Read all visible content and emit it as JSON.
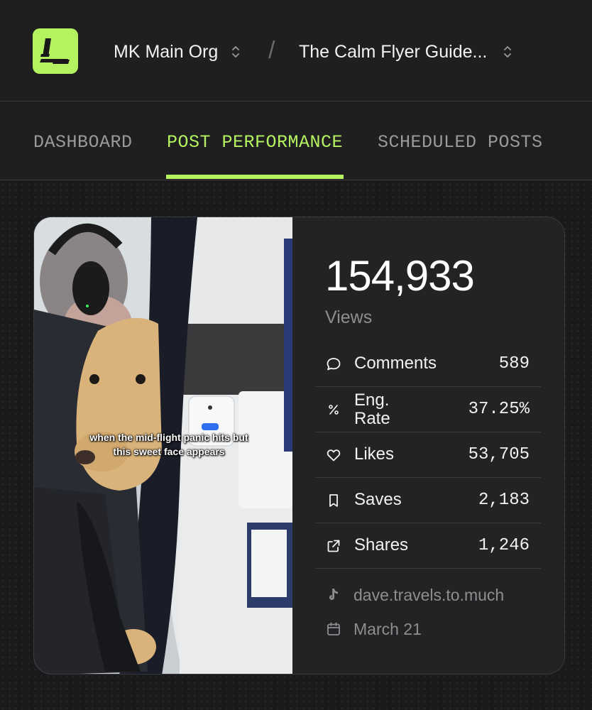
{
  "header": {
    "org_name": "MK Main Org",
    "separator": "/",
    "project_name": "The Calm Flyer Guide..."
  },
  "tabs": [
    {
      "label": "DASHBOARD",
      "active": false
    },
    {
      "label": "POST PERFORMANCE",
      "active": true
    },
    {
      "label": "SCHEDULED POSTS",
      "active": false
    }
  ],
  "post": {
    "caption_line1": "when the mid-flight panic hits but",
    "caption_line2": "this sweet face appears",
    "views_value": "154,933",
    "views_label": "Views",
    "metrics": [
      {
        "icon": "comment-icon",
        "label": "Comments",
        "value": "589"
      },
      {
        "icon": "percent-icon",
        "label_line1": "Eng.",
        "label_line2": "Rate",
        "value": "37.25%"
      },
      {
        "icon": "heart-icon",
        "label": "Likes",
        "value": "53,705"
      },
      {
        "icon": "bookmark-icon",
        "label": "Saves",
        "value": "2,183"
      },
      {
        "icon": "share-icon",
        "label": "Shares",
        "value": "1,246"
      }
    ],
    "account": {
      "icon": "tiktok-icon",
      "handle": "dave.travels.to.much"
    },
    "date": {
      "icon": "calendar-icon",
      "text": "March 21"
    }
  },
  "colors": {
    "accent": "#b5f260",
    "background": "#1c1c1e",
    "card": "#232325",
    "muted": "#8e8e91"
  }
}
